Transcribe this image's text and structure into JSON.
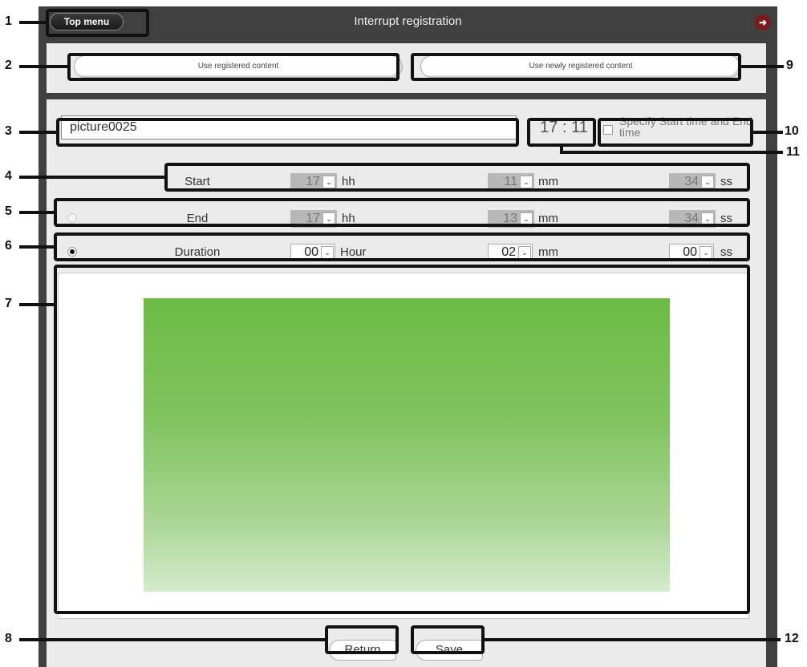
{
  "header": {
    "top_menu_label": "Top menu",
    "title": "Interrupt registration",
    "logout_icon": "logout-icon"
  },
  "content_buttons": {
    "registered": "Use registered content",
    "newly_registered": "Use newly registered content"
  },
  "content_name": "picture0025",
  "clock": "17 : 11",
  "specify_time_label": "Specify Start time and End time",
  "rows": {
    "start": {
      "label": "Start",
      "f1": "17",
      "u1": "hh",
      "f2": "11",
      "u2": "mm",
      "f3": "34",
      "u3": "ss"
    },
    "end": {
      "label": "End",
      "f1": "17",
      "u1": "hh",
      "f2": "13",
      "u2": "mm",
      "f3": "34",
      "u3": "ss"
    },
    "duration": {
      "label": "Duration",
      "f1": "00",
      "u1": "Hour",
      "f2": "02",
      "u2": "mm",
      "f3": "00",
      "u3": "ss"
    }
  },
  "footer": {
    "return_label": "Return",
    "save_label": "Save"
  },
  "callouts": [
    "1",
    "2",
    "3",
    "4",
    "5",
    "6",
    "7",
    "8",
    "9",
    "10",
    "11",
    "12"
  ],
  "colors": {
    "frame": "#404040",
    "panel": "#ebebeb",
    "preview_green": "#6dbb45",
    "logout": "#7a1a1a"
  }
}
